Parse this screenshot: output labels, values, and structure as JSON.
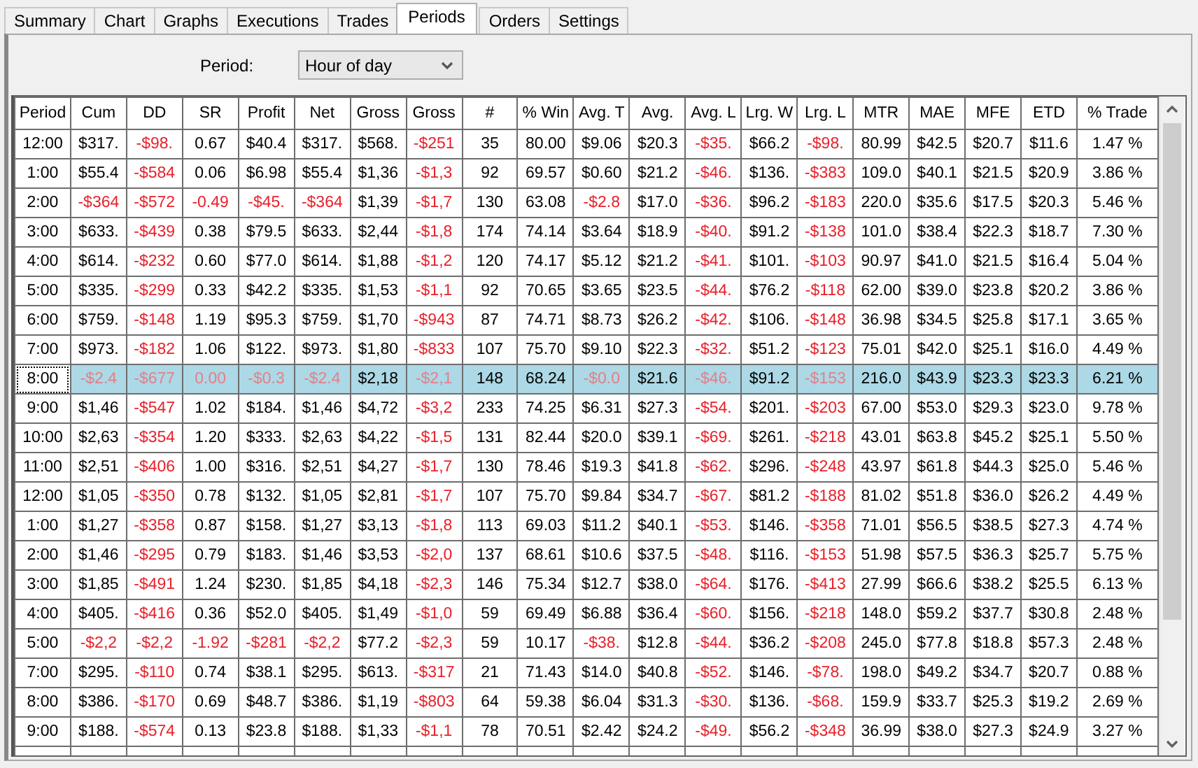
{
  "tabs": [
    {
      "label": "Summary",
      "selected": false
    },
    {
      "label": "Chart",
      "selected": false
    },
    {
      "label": "Graphs",
      "selected": false
    },
    {
      "label": "Executions",
      "selected": false
    },
    {
      "label": "Trades",
      "selected": false
    },
    {
      "label": "Periods",
      "selected": true
    },
    {
      "label": "Orders",
      "selected": false
    },
    {
      "label": "Settings",
      "selected": false
    }
  ],
  "period_filter": {
    "label": "Period:",
    "value": "Hour of day"
  },
  "table": {
    "columns": [
      "Period",
      "Cum",
      "DD",
      "SR",
      "Profit",
      "Net",
      "Gross",
      "Gross",
      "#",
      "% Win",
      "Avg. T",
      "Avg.",
      "Avg. L",
      "Lrg. W",
      "Lrg. L",
      "MTR",
      "MAE",
      "MFE",
      "ETD",
      "% Trade"
    ],
    "rows": [
      {
        "selected": false,
        "cells": [
          "12:00",
          "$317.",
          "-$98.",
          "0.67",
          "$40.4",
          "$317.",
          "$568.",
          "-$251",
          "35",
          "80.00",
          "$9.06",
          "$20.3",
          "-$35.",
          "$66.2",
          "-$98.",
          "80.99",
          "$42.5",
          "$20.7",
          "$11.6",
          "1.47 %"
        ],
        "negative": [
          false,
          false,
          true,
          false,
          false,
          false,
          false,
          true,
          false,
          false,
          false,
          false,
          true,
          false,
          true,
          false,
          false,
          false,
          false,
          false
        ]
      },
      {
        "selected": false,
        "cells": [
          "1:00",
          "$55.4",
          "-$584",
          "0.06",
          "$6.98",
          "$55.4",
          "$1,36",
          "-$1,3",
          "92",
          "69.57",
          "$0.60",
          "$21.2",
          "-$46.",
          "$136.",
          "-$383",
          "109.0",
          "$40.1",
          "$21.5",
          "$20.9",
          "3.86 %"
        ],
        "negative": [
          false,
          false,
          true,
          false,
          false,
          false,
          false,
          true,
          false,
          false,
          false,
          false,
          true,
          false,
          true,
          false,
          false,
          false,
          false,
          false
        ]
      },
      {
        "selected": false,
        "cells": [
          "2:00",
          "-$364",
          "-$572",
          "-0.49",
          "-$45.",
          "-$364",
          "$1,39",
          "-$1,7",
          "130",
          "63.08",
          "-$2.8",
          "$17.0",
          "-$36.",
          "$96.2",
          "-$183",
          "220.0",
          "$35.6",
          "$17.5",
          "$20.3",
          "5.46 %"
        ],
        "negative": [
          false,
          true,
          true,
          true,
          true,
          true,
          false,
          true,
          false,
          false,
          true,
          false,
          true,
          false,
          true,
          false,
          false,
          false,
          false,
          false
        ]
      },
      {
        "selected": false,
        "cells": [
          "3:00",
          "$633.",
          "-$439",
          "0.38",
          "$79.5",
          "$633.",
          "$2,44",
          "-$1,8",
          "174",
          "74.14",
          "$3.64",
          "$18.9",
          "-$40.",
          "$91.2",
          "-$138",
          "101.0",
          "$38.4",
          "$22.3",
          "$18.7",
          "7.30 %"
        ],
        "negative": [
          false,
          false,
          true,
          false,
          false,
          false,
          false,
          true,
          false,
          false,
          false,
          false,
          true,
          false,
          true,
          false,
          false,
          false,
          false,
          false
        ]
      },
      {
        "selected": false,
        "cells": [
          "4:00",
          "$614.",
          "-$232",
          "0.60",
          "$77.0",
          "$614.",
          "$1,88",
          "-$1,2",
          "120",
          "74.17",
          "$5.12",
          "$21.2",
          "-$41.",
          "$101.",
          "-$103",
          "90.97",
          "$41.0",
          "$21.5",
          "$16.4",
          "5.04 %"
        ],
        "negative": [
          false,
          false,
          true,
          false,
          false,
          false,
          false,
          true,
          false,
          false,
          false,
          false,
          true,
          false,
          true,
          false,
          false,
          false,
          false,
          false
        ]
      },
      {
        "selected": false,
        "cells": [
          "5:00",
          "$335.",
          "-$299",
          "0.33",
          "$42.2",
          "$335.",
          "$1,53",
          "-$1,1",
          "92",
          "70.65",
          "$3.65",
          "$23.5",
          "-$44.",
          "$76.2",
          "-$118",
          "62.00",
          "$39.0",
          "$23.8",
          "$20.2",
          "3.86 %"
        ],
        "negative": [
          false,
          false,
          true,
          false,
          false,
          false,
          false,
          true,
          false,
          false,
          false,
          false,
          true,
          false,
          true,
          false,
          false,
          false,
          false,
          false
        ]
      },
      {
        "selected": false,
        "cells": [
          "6:00",
          "$759.",
          "-$148",
          "1.19",
          "$95.3",
          "$759.",
          "$1,70",
          "-$943",
          "87",
          "74.71",
          "$8.73",
          "$26.2",
          "-$42.",
          "$106.",
          "-$148",
          "36.98",
          "$34.5",
          "$25.8",
          "$17.1",
          "3.65 %"
        ],
        "negative": [
          false,
          false,
          true,
          false,
          false,
          false,
          false,
          true,
          false,
          false,
          false,
          false,
          true,
          false,
          true,
          false,
          false,
          false,
          false,
          false
        ]
      },
      {
        "selected": false,
        "cells": [
          "7:00",
          "$973.",
          "-$182",
          "1.06",
          "$122.",
          "$973.",
          "$1,80",
          "-$833",
          "107",
          "75.70",
          "$9.10",
          "$22.3",
          "-$32.",
          "$51.2",
          "-$123",
          "75.01",
          "$42.0",
          "$25.1",
          "$16.0",
          "4.49 %"
        ],
        "negative": [
          false,
          false,
          true,
          false,
          false,
          false,
          false,
          true,
          false,
          false,
          false,
          false,
          true,
          false,
          true,
          false,
          false,
          false,
          false,
          false
        ]
      },
      {
        "selected": true,
        "cells": [
          "8:00",
          "-$2.4",
          "-$677",
          "0.00",
          "-$0.3",
          "-$2.4",
          "$2,18",
          "-$2,1",
          "148",
          "68.24",
          "-$0.0",
          "$21.6",
          "-$46.",
          "$91.2",
          "-$153",
          "216.0",
          "$43.9",
          "$23.3",
          "$23.3",
          "6.21 %"
        ],
        "negative": [
          false,
          true,
          true,
          true,
          true,
          true,
          false,
          true,
          false,
          false,
          true,
          false,
          true,
          false,
          true,
          false,
          false,
          false,
          false,
          false
        ]
      },
      {
        "selected": false,
        "cells": [
          "9:00",
          "$1,46",
          "-$547",
          "1.02",
          "$184.",
          "$1,46",
          "$4,72",
          "-$3,2",
          "233",
          "74.25",
          "$6.31",
          "$27.3",
          "-$54.",
          "$201.",
          "-$203",
          "67.00",
          "$53.0",
          "$29.3",
          "$23.0",
          "9.78 %"
        ],
        "negative": [
          false,
          false,
          true,
          false,
          false,
          false,
          false,
          true,
          false,
          false,
          false,
          false,
          true,
          false,
          true,
          false,
          false,
          false,
          false,
          false
        ]
      },
      {
        "selected": false,
        "cells": [
          "10:00",
          "$2,63",
          "-$354",
          "1.20",
          "$333.",
          "$2,63",
          "$4,22",
          "-$1,5",
          "131",
          "82.44",
          "$20.0",
          "$39.1",
          "-$69.",
          "$261.",
          "-$218",
          "43.01",
          "$63.8",
          "$45.2",
          "$25.1",
          "5.50 %"
        ],
        "negative": [
          false,
          false,
          true,
          false,
          false,
          false,
          false,
          true,
          false,
          false,
          false,
          false,
          true,
          false,
          true,
          false,
          false,
          false,
          false,
          false
        ]
      },
      {
        "selected": false,
        "cells": [
          "11:00",
          "$2,51",
          "-$406",
          "1.00",
          "$316.",
          "$2,51",
          "$4,27",
          "-$1,7",
          "130",
          "78.46",
          "$19.3",
          "$41.8",
          "-$62.",
          "$296.",
          "-$248",
          "43.97",
          "$61.8",
          "$44.3",
          "$25.0",
          "5.46 %"
        ],
        "negative": [
          false,
          false,
          true,
          false,
          false,
          false,
          false,
          true,
          false,
          false,
          false,
          false,
          true,
          false,
          true,
          false,
          false,
          false,
          false,
          false
        ]
      },
      {
        "selected": false,
        "cells": [
          "12:00",
          "$1,05",
          "-$350",
          "0.78",
          "$132.",
          "$1,05",
          "$2,81",
          "-$1,7",
          "107",
          "75.70",
          "$9.84",
          "$34.7",
          "-$67.",
          "$81.2",
          "-$188",
          "81.02",
          "$51.8",
          "$36.0",
          "$26.2",
          "4.49 %"
        ],
        "negative": [
          false,
          false,
          true,
          false,
          false,
          false,
          false,
          true,
          false,
          false,
          false,
          false,
          true,
          false,
          true,
          false,
          false,
          false,
          false,
          false
        ]
      },
      {
        "selected": false,
        "cells": [
          "1:00",
          "$1,27",
          "-$358",
          "0.87",
          "$158.",
          "$1,27",
          "$3,13",
          "-$1,8",
          "113",
          "69.03",
          "$11.2",
          "$40.1",
          "-$53.",
          "$146.",
          "-$358",
          "71.01",
          "$56.5",
          "$38.5",
          "$27.3",
          "4.74 %"
        ],
        "negative": [
          false,
          false,
          true,
          false,
          false,
          false,
          false,
          true,
          false,
          false,
          false,
          false,
          true,
          false,
          true,
          false,
          false,
          false,
          false,
          false
        ]
      },
      {
        "selected": false,
        "cells": [
          "2:00",
          "$1,46",
          "-$295",
          "0.79",
          "$183.",
          "$1,46",
          "$3,53",
          "-$2,0",
          "137",
          "68.61",
          "$10.6",
          "$37.5",
          "-$48.",
          "$116.",
          "-$153",
          "51.98",
          "$57.5",
          "$36.3",
          "$25.7",
          "5.75 %"
        ],
        "negative": [
          false,
          false,
          true,
          false,
          false,
          false,
          false,
          true,
          false,
          false,
          false,
          false,
          true,
          false,
          true,
          false,
          false,
          false,
          false,
          false
        ]
      },
      {
        "selected": false,
        "cells": [
          "3:00",
          "$1,85",
          "-$491",
          "1.24",
          "$230.",
          "$1,85",
          "$4,18",
          "-$2,3",
          "146",
          "75.34",
          "$12.7",
          "$38.0",
          "-$64.",
          "$176.",
          "-$413",
          "27.99",
          "$66.6",
          "$38.2",
          "$25.5",
          "6.13 %"
        ],
        "negative": [
          false,
          false,
          true,
          false,
          false,
          false,
          false,
          true,
          false,
          false,
          false,
          false,
          true,
          false,
          true,
          false,
          false,
          false,
          false,
          false
        ]
      },
      {
        "selected": false,
        "cells": [
          "4:00",
          "$405.",
          "-$416",
          "0.36",
          "$52.0",
          "$405.",
          "$1,49",
          "-$1,0",
          "59",
          "69.49",
          "$6.88",
          "$36.4",
          "-$60.",
          "$156.",
          "-$218",
          "148.0",
          "$59.2",
          "$37.7",
          "$30.8",
          "2.48 %"
        ],
        "negative": [
          false,
          false,
          true,
          false,
          false,
          false,
          false,
          true,
          false,
          false,
          false,
          false,
          true,
          false,
          true,
          false,
          false,
          false,
          false,
          false
        ]
      },
      {
        "selected": false,
        "cells": [
          "5:00",
          "-$2,2",
          "-$2,2",
          "-1.92",
          "-$281",
          "-$2,2",
          "$77.2",
          "-$2,3",
          "59",
          "10.17",
          "-$38.",
          "$12.8",
          "-$44.",
          "$36.2",
          "-$208",
          "245.0",
          "$77.8",
          "$18.8",
          "$57.3",
          "2.48 %"
        ],
        "negative": [
          false,
          true,
          true,
          true,
          true,
          true,
          false,
          true,
          false,
          false,
          true,
          false,
          true,
          false,
          true,
          false,
          false,
          false,
          false,
          false
        ]
      },
      {
        "selected": false,
        "cells": [
          "7:00",
          "$295.",
          "-$110",
          "0.74",
          "$38.1",
          "$295.",
          "$613.",
          "-$317",
          "21",
          "71.43",
          "$14.0",
          "$40.8",
          "-$52.",
          "$146.",
          "-$78.",
          "198.0",
          "$49.2",
          "$34.7",
          "$20.7",
          "0.88 %"
        ],
        "negative": [
          false,
          false,
          true,
          false,
          false,
          false,
          false,
          true,
          false,
          false,
          false,
          false,
          true,
          false,
          true,
          false,
          false,
          false,
          false,
          false
        ]
      },
      {
        "selected": false,
        "cells": [
          "8:00",
          "$386.",
          "-$170",
          "0.69",
          "$48.7",
          "$386.",
          "$1,19",
          "-$803",
          "64",
          "59.38",
          "$6.04",
          "$31.3",
          "-$30.",
          "$136.",
          "-$68.",
          "159.9",
          "$33.7",
          "$25.3",
          "$19.2",
          "2.69 %"
        ],
        "negative": [
          false,
          false,
          true,
          false,
          false,
          false,
          false,
          true,
          false,
          false,
          false,
          false,
          true,
          false,
          true,
          false,
          false,
          false,
          false,
          false
        ]
      },
      {
        "selected": false,
        "cells": [
          "9:00",
          "$188.",
          "-$574",
          "0.13",
          "$23.8",
          "$188.",
          "$1,33",
          "-$1,1",
          "78",
          "70.51",
          "$2.42",
          "$24.2",
          "-$49.",
          "$56.2",
          "-$348",
          "36.99",
          "$38.0",
          "$27.3",
          "$24.9",
          "3.27 %"
        ],
        "negative": [
          false,
          false,
          true,
          false,
          false,
          false,
          false,
          true,
          false,
          false,
          false,
          false,
          true,
          false,
          true,
          false,
          false,
          false,
          false,
          false
        ]
      }
    ]
  }
}
